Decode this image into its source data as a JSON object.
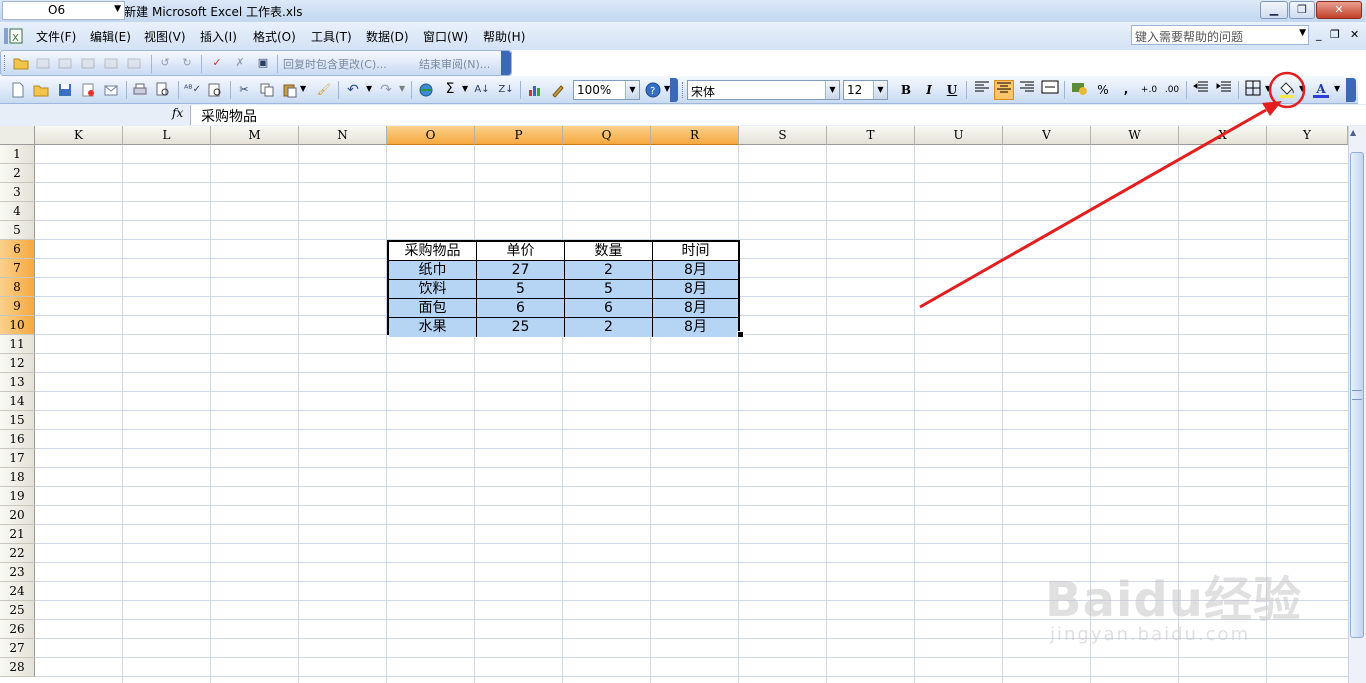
{
  "window": {
    "title": "Microsoft Excel - 新建 Microsoft Excel 工作表.xls",
    "app_icon": "excel-app-icon",
    "buttons": {
      "minimize": "▁",
      "restore": "❐",
      "close": "✕"
    }
  },
  "menubar": {
    "items": [
      {
        "label": "文件(F)"
      },
      {
        "label": "编辑(E)"
      },
      {
        "label": "视图(V)"
      },
      {
        "label": "插入(I)"
      },
      {
        "label": "格式(O)"
      },
      {
        "label": "工具(T)"
      },
      {
        "label": "数据(D)"
      },
      {
        "label": "窗口(W)"
      },
      {
        "label": "帮助(H)"
      }
    ],
    "help_placeholder": "键入需要帮助的问题",
    "mdi": {
      "minimize": "_",
      "restore": "❐",
      "close": "✕"
    }
  },
  "toolbar_reviewing": {
    "reply_changes": "回复时包含更改(C)...",
    "end_review": "结束审阅(N)..."
  },
  "toolbar_standard": {
    "zoom": "100%",
    "font_name": "宋体",
    "font_size": "12",
    "bold": "B",
    "italic": "I",
    "underline": "U",
    "percent": "%",
    "comma": ",",
    "sigma": "Σ"
  },
  "formula_bar": {
    "name_box": "O6",
    "fx": "fx",
    "content": "采购物品"
  },
  "sheet": {
    "columns": [
      "K",
      "L",
      "M",
      "N",
      "O",
      "P",
      "Q",
      "R",
      "S",
      "T",
      "U",
      "V",
      "W",
      "X",
      "Y"
    ],
    "selected_columns": [
      "O",
      "P",
      "Q",
      "R"
    ],
    "rows": [
      "1",
      "2",
      "3",
      "4",
      "5",
      "6",
      "7",
      "8",
      "9",
      "10",
      "11",
      "12",
      "13",
      "14",
      "15",
      "16",
      "17",
      "18",
      "19",
      "20",
      "21",
      "22",
      "23",
      "24",
      "25",
      "26",
      "27",
      "28"
    ],
    "selected_rows": [
      "6",
      "7",
      "8",
      "9",
      "10"
    ],
    "table": {
      "header": [
        "采购物品",
        "单价",
        "数量",
        "时间"
      ],
      "rows": [
        [
          "纸巾",
          "27",
          "2",
          "8月"
        ],
        [
          "饮料",
          "5",
          "5",
          "8月"
        ],
        [
          "面包",
          "6",
          "6",
          "8月"
        ],
        [
          "水果",
          "25",
          "2",
          "8月"
        ]
      ]
    }
  },
  "annotation": {
    "color": "#e21e1e",
    "target": "fill-color-icon"
  },
  "watermark": {
    "brand": "Baidu经验",
    "url": "jingyan.baidu.com"
  }
}
